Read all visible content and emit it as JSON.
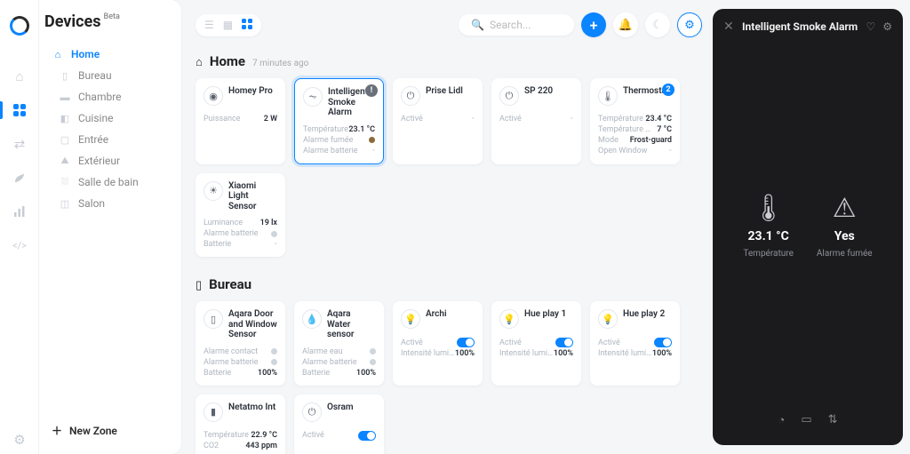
{
  "app": {
    "title": "Devices",
    "badge": "Beta"
  },
  "zones": {
    "root": "Home",
    "items": [
      "Bureau",
      "Chambre",
      "Cuisine",
      "Entrée",
      "Extérieur",
      "Salle de bain",
      "Salon"
    ]
  },
  "new_zone": "New Zone",
  "search_placeholder": "Search...",
  "sections": [
    {
      "icon": "home",
      "title": "Home",
      "ago": "7 minutes ago",
      "cards": [
        {
          "name": "Homey Pro",
          "icon": "ring",
          "rows": [
            {
              "lbl": "Puissance",
              "val": "2 W"
            }
          ]
        },
        {
          "name": "Intelligent Smoke Alarm",
          "icon": "alarm",
          "selected": true,
          "badge": "!",
          "rows": [
            {
              "lbl": "Température",
              "val": "23.1 °C"
            },
            {
              "lbl": "Alarme fumée",
              "dot": "on"
            },
            {
              "lbl": "Alarme batterie",
              "dash": true
            }
          ]
        },
        {
          "name": "Prise Lidl",
          "icon": "plug",
          "rows": [
            {
              "lbl": "Activé",
              "dash": true
            }
          ]
        },
        {
          "name": "SP 220",
          "icon": "plug",
          "rows": [
            {
              "lbl": "Activé",
              "dash": true
            }
          ]
        },
        {
          "name": "Thermostat",
          "icon": "thermo",
          "badge": "2",
          "badgeblue": true,
          "rows": [
            {
              "lbl": "Température",
              "val": "23.4 °C"
            },
            {
              "lbl": "Température cible",
              "val": "7 °C"
            },
            {
              "lbl": "Mode",
              "val": "Frost-guard"
            },
            {
              "lbl": "Open Window",
              "dash": true
            }
          ]
        },
        {
          "name": "Xiaomi Light Sensor",
          "icon": "light",
          "rows": [
            {
              "lbl": "Luminance",
              "val": "19 lx"
            },
            {
              "lbl": "Alarme batterie",
              "dot": "off"
            },
            {
              "lbl": "Batterie",
              "dash": true
            }
          ]
        }
      ]
    },
    {
      "icon": "briefcase",
      "title": "Bureau",
      "cards": [
        {
          "name": "Aqara Door and Window Sensor",
          "icon": "door",
          "rows": [
            {
              "lbl": "Alarme contact",
              "dot": "off"
            },
            {
              "lbl": "Alarme batterie",
              "dot": "off"
            },
            {
              "lbl": "Batterie",
              "val": "100%"
            }
          ]
        },
        {
          "name": "Aqara Water sensor",
          "icon": "water",
          "rows": [
            {
              "lbl": "Alarme eau",
              "dot": "off"
            },
            {
              "lbl": "Alarme batterie",
              "dot": "off"
            },
            {
              "lbl": "Batterie",
              "val": "100%"
            }
          ]
        },
        {
          "name": "Archi",
          "icon": "bulb",
          "rows": [
            {
              "lbl": "Activé",
              "toggle": true
            },
            {
              "lbl": "Intensité lumineu...",
              "val": "100%"
            }
          ]
        },
        {
          "name": "Hue play 1",
          "icon": "bulb",
          "rows": [
            {
              "lbl": "Activé",
              "toggle": true
            },
            {
              "lbl": "Intensité lumineu...",
              "val": "100%"
            }
          ]
        },
        {
          "name": "Hue play 2",
          "icon": "bulb",
          "rows": [
            {
              "lbl": "Activé",
              "toggle": true
            },
            {
              "lbl": "Intensité lumineu...",
              "val": "100%"
            }
          ]
        },
        {
          "name": "Netatmo Int",
          "icon": "netatmo",
          "rows": [
            {
              "lbl": "Température",
              "val": "22.9 °C"
            },
            {
              "lbl": "CO2",
              "val": "443 ppm"
            }
          ]
        },
        {
          "name": "Osram",
          "icon": "plug",
          "rows": [
            {
              "lbl": "Activé",
              "toggle": true
            }
          ]
        }
      ]
    }
  ],
  "detail": {
    "title": "Intelligent Smoke Alarm",
    "metrics": [
      {
        "glyph": "🌡",
        "val": "23.1 °C",
        "lbl": "Température"
      },
      {
        "glyph": "⚠",
        "val": "Yes",
        "lbl": "Alarme fumée"
      }
    ]
  }
}
